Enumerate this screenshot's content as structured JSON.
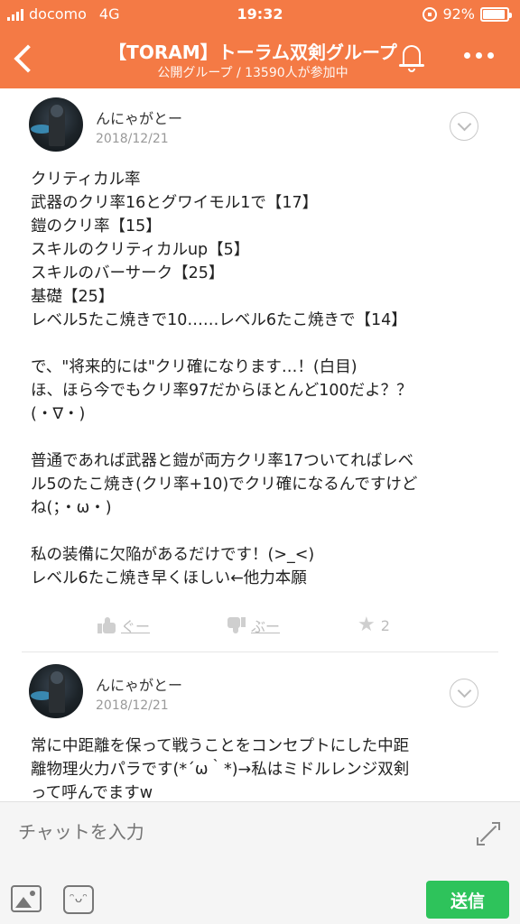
{
  "status": {
    "carrier": "docomo",
    "network": "4G",
    "time": "19:32",
    "battery": "92%",
    "battery_fraction": 0.92
  },
  "nav": {
    "title": "【TORAM】トーラム双剣グループ",
    "subtitle": "公開グループ / 13590人が参加中",
    "back_icon": "chevron-left-icon",
    "bell_icon": "bell-icon",
    "more_icon": "more-icon"
  },
  "posts": [
    {
      "author": "んにゃがとー",
      "date": "2018/12/21",
      "lines": [
        "クリティカル率",
        "武器のクリ率16とグワイモル1で【17】",
        "鎧のクリ率【15】",
        "スキルのクリティカルup【5】",
        "スキルのバーサーク【25】",
        "基礎【25】",
        "レベル5たこ焼きで10……レベル6たこ焼きで【14】",
        "",
        "で、\"将来的には\"クリ確になります…！(白目)",
        "ほ、ほら今でもクリ率97だからほとんど100だよ？？",
        "(・∇・)",
        "",
        "普通であれば武器と鎧が両方クリ率17ついてればレベ",
        "ル5のたこ焼き(クリ率+10)でクリ確になるんですけど",
        "ね(；・ω・)",
        "",
        "私の装備に欠陥があるだけです！(>_<)",
        "レベル6たこ焼き早くほしい←他力本願"
      ],
      "good_label": "ぐー",
      "bad_label": "ぶー",
      "star_count": "2"
    },
    {
      "author": "んにゃがとー",
      "date": "2018/12/21",
      "lines": [
        "常に中距離を保って戦うことをコンセプトにした中距",
        "離物理火力パラです(*´ω｀*)→私はミドルレンジ双剣",
        "って呼んでますw"
      ]
    }
  ],
  "input": {
    "placeholder": "チャットを入力",
    "send_label": "送信"
  },
  "colors": {
    "header": "#f47a45",
    "send": "#2ec35b"
  }
}
